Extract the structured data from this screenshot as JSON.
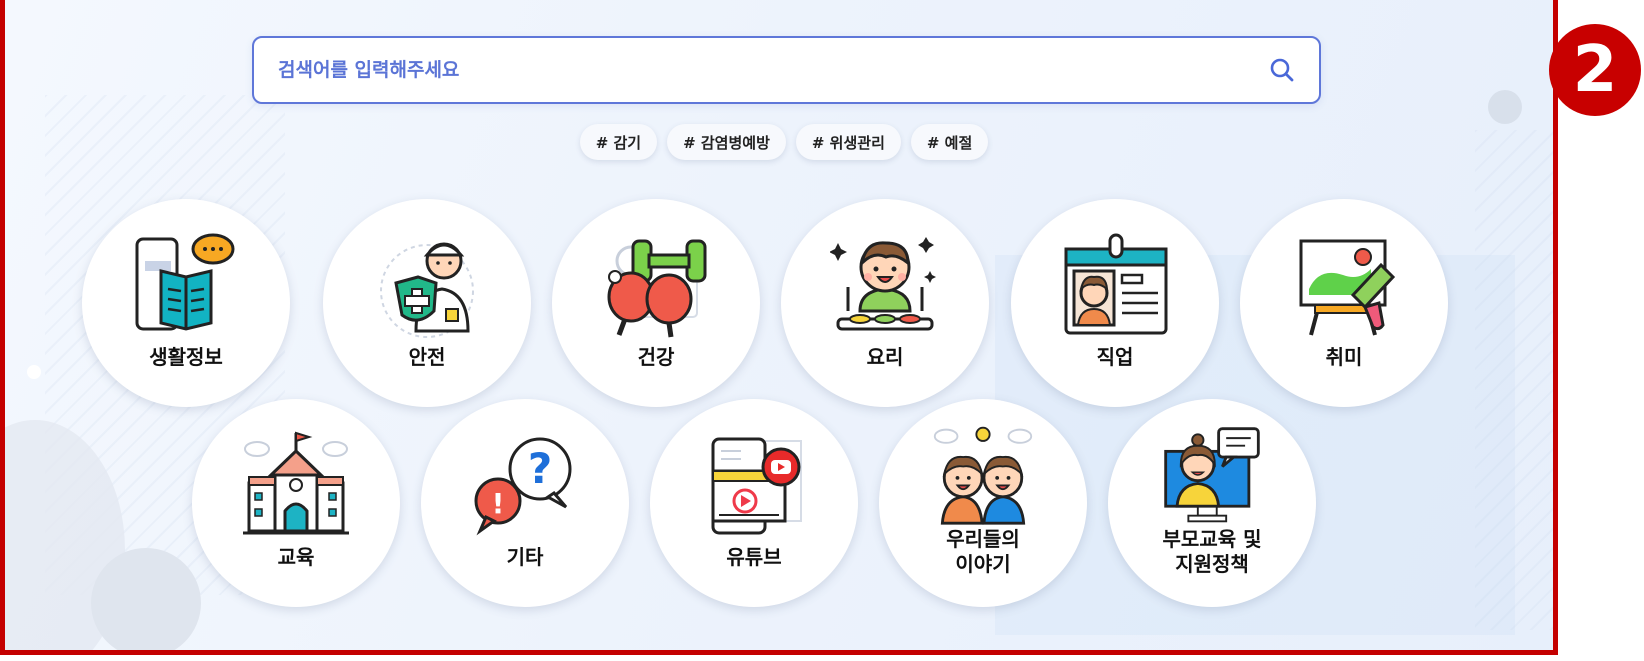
{
  "search": {
    "placeholder": "검색어를 입력해주세요"
  },
  "tags": [
    "# 감기",
    "# 감염병예방",
    "# 위생관리",
    "# 예절"
  ],
  "categories_row1": [
    {
      "label": "생활정보",
      "icon": "book-phone-icon"
    },
    {
      "label": "안전",
      "icon": "safety-shield-icon"
    },
    {
      "label": "건강",
      "icon": "dumbbell-pingpong-icon"
    },
    {
      "label": "요리",
      "icon": "child-meal-icon"
    },
    {
      "label": "직업",
      "icon": "id-card-icon"
    },
    {
      "label": "취미",
      "icon": "easel-painting-icon"
    }
  ],
  "categories_row2": [
    {
      "label": "교육",
      "icon": "school-building-icon"
    },
    {
      "label": "기타",
      "icon": "question-bubble-icon"
    },
    {
      "label": "유튜브",
      "icon": "youtube-video-icon"
    },
    {
      "label": "우리들의\n이야기",
      "icon": "two-kids-icon"
    },
    {
      "label": "부모교육 및\n지원정책",
      "icon": "teacher-monitor-icon"
    }
  ],
  "badge": "2",
  "colors": {
    "frame_border": "#c40000",
    "search_border": "#5f77d9",
    "badge": "#c80000"
  }
}
